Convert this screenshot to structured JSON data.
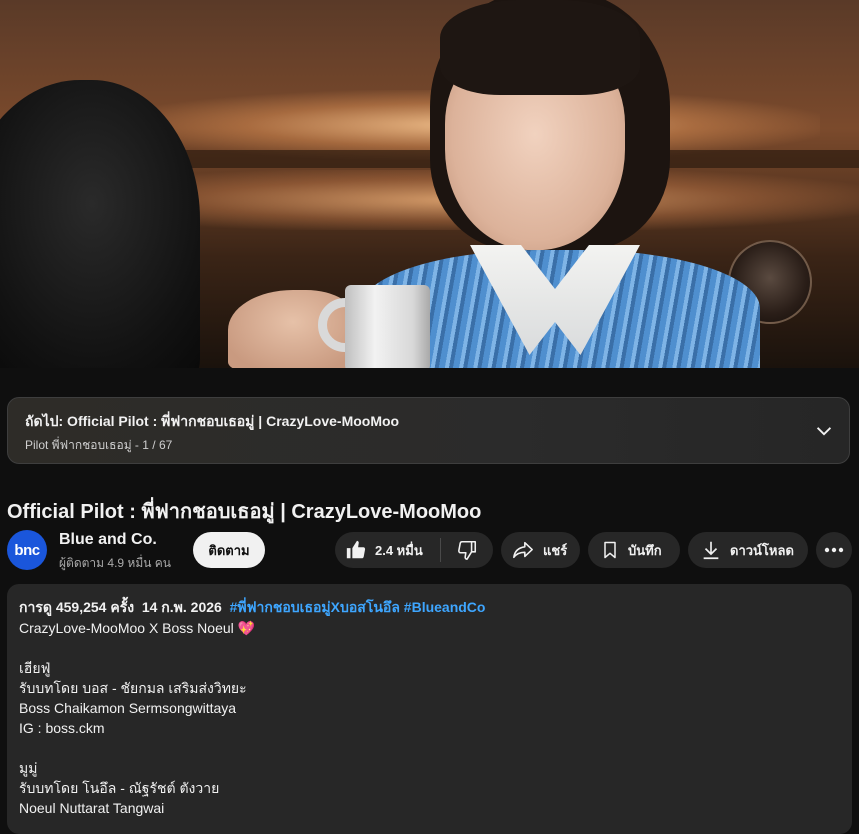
{
  "player": {
    "thumbnail_icon": "video-frame"
  },
  "next_bar": {
    "title": "ถัดไป: Official Pilot : พี่ฟากชอบเธอมู่ | CrazyLove-MooMoo",
    "subtitle": "Pilot พี่ฟากชอบเธอมู่ - 1 / 67",
    "icon": "chevron-down-icon"
  },
  "video": {
    "title": "Official Pilot : พี่ฟากชอบเธอมู่ | CrazyLove-MooMoo"
  },
  "channel": {
    "avatar_text": "bnc",
    "name": "Blue and Co.",
    "subscribers": "ผู้ติดตาม 4.9 หมื่น คน",
    "subscribe_label": "ติดตาม",
    "avatar_color": "#1a56db"
  },
  "actions": {
    "like_count": "2.4 หมื่น",
    "share_label": "แชร์",
    "save_label": "บันทึก",
    "download_label": "ดาวน์โหลด"
  },
  "description": {
    "views": "การดู 459,254 ครั้ง",
    "date": "14 ก.พ. 2026",
    "hashtag1": "#พี่ฟากชอบเธอมู่Xบอสโนอึล",
    "hashtag2": "#BlueandCo",
    "line1": "CrazyLove-MooMoo X Boss Noeul",
    "line1_emoji": "💖",
    "line2": "",
    "line3": "เฮียฟู่",
    "line4": "รับบทโดย บอส - ชัยกมล เสริมส่งวิทยะ",
    "line5": "Boss Chaikamon Sermsongwittaya",
    "line6": "IG : boss.ckm",
    "line7": "",
    "line8": "มูมู่",
    "line9": "รับบทโดย โนอึล - ณัฐรัชต์ ตังวาย",
    "line10": "Noeul Nuttarat Tangwai"
  },
  "colors": {
    "background": "#0f0f0f",
    "surface": "#272727",
    "link": "#3ea6ff",
    "text": "#f1f1f1",
    "muted": "#aaaaaa"
  }
}
